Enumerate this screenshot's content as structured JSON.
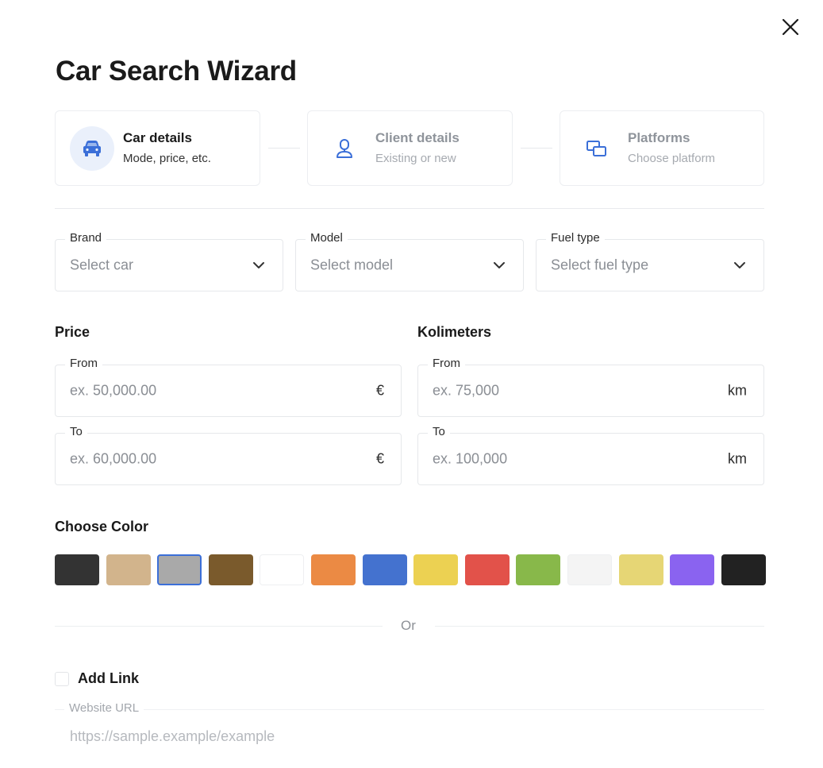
{
  "dialog": {
    "title": "Car Search Wizard",
    "close_icon": "close-icon"
  },
  "steps": [
    {
      "title": "Car details",
      "subtitle": "Mode, price, etc.",
      "icon": "car-icon",
      "state": "active"
    },
    {
      "title": "Client details",
      "subtitle": "Existing or new",
      "icon": "user-icon",
      "state": "inactive"
    },
    {
      "title": "Platforms",
      "subtitle": "Choose platform",
      "icon": "platforms-icon",
      "state": "inactive"
    }
  ],
  "filters": {
    "brand": {
      "label": "Brand",
      "placeholder": "Select car"
    },
    "model": {
      "label": "Model",
      "placeholder": "Select model"
    },
    "fuel": {
      "label": "Fuel type",
      "placeholder": "Select fuel type"
    }
  },
  "price": {
    "heading": "Price",
    "from": {
      "label": "From",
      "placeholder": "ex. 50,000.00",
      "unit": "€"
    },
    "to": {
      "label": "To",
      "placeholder": "ex. 60,000.00",
      "unit": "€"
    }
  },
  "kilometers": {
    "heading": "Kolimeters",
    "from": {
      "label": "From",
      "placeholder": "ex. 75,000",
      "unit": "km"
    },
    "to": {
      "label": "To",
      "placeholder": "ex. 100,000",
      "unit": "km"
    }
  },
  "colors": {
    "heading": "Choose Color",
    "selected_index": 2,
    "accent": "#3b6fd8",
    "swatches": [
      "#333333",
      "#d2b48c",
      "#a9a9a9",
      "#7a5a2c",
      "#ffffff",
      "#eb8a44",
      "#4472cf",
      "#ecd152",
      "#e2524a",
      "#88b84a",
      "#f4f4f4",
      "#e6d675",
      "#8a63f0",
      "#222222"
    ]
  },
  "separator": {
    "text": "Or"
  },
  "link": {
    "checkbox_label": "Add Link",
    "checked": false,
    "url": {
      "label": "Website URL",
      "placeholder": "https://sample.example/example"
    }
  }
}
